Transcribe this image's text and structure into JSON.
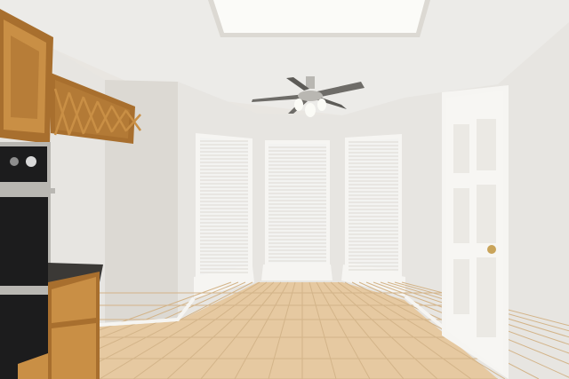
{
  "scene": {
    "kind": "room-photo",
    "objects": [
      "skylight",
      "ceiling-fan",
      "bay-window",
      "window-blinds",
      "oak-cabinets",
      "wine-rack",
      "wall-oven",
      "countertop",
      "paneled-door",
      "tile-floor"
    ]
  },
  "colors": {
    "ceiling": "#ecebe8",
    "wall": "#e7e5e1",
    "wall_shadow": "#dcd9d3",
    "trim": "#f6f5f2",
    "skylight": "#fbfbf8",
    "oak": "#c98f45",
    "oak_dark": "#a86f2e",
    "oven": "#1c1c1d",
    "oven_steel": "#b9b7b2",
    "counter": "#3b3936",
    "floor": "#e6c9a1",
    "grout": "#d3b489",
    "blind": "#f3f3f1",
    "door": "#f7f6f3"
  }
}
